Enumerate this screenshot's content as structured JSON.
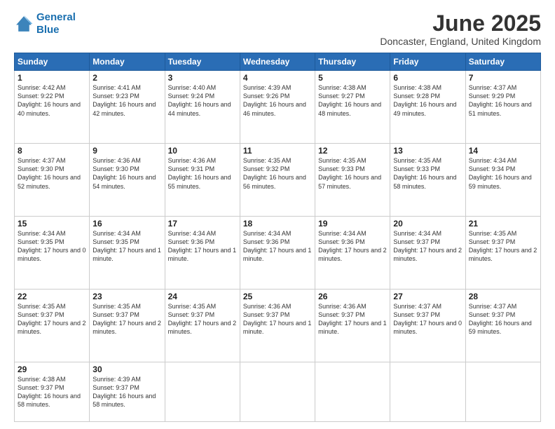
{
  "logo": {
    "line1": "General",
    "line2": "Blue"
  },
  "title": "June 2025",
  "location": "Doncaster, England, United Kingdom",
  "days_header": [
    "Sunday",
    "Monday",
    "Tuesday",
    "Wednesday",
    "Thursday",
    "Friday",
    "Saturday"
  ],
  "weeks": [
    [
      {
        "day": "1",
        "rise": "Sunrise: 4:42 AM",
        "set": "Sunset: 9:22 PM",
        "daylight": "Daylight: 16 hours and 40 minutes."
      },
      {
        "day": "2",
        "rise": "Sunrise: 4:41 AM",
        "set": "Sunset: 9:23 PM",
        "daylight": "Daylight: 16 hours and 42 minutes."
      },
      {
        "day": "3",
        "rise": "Sunrise: 4:40 AM",
        "set": "Sunset: 9:24 PM",
        "daylight": "Daylight: 16 hours and 44 minutes."
      },
      {
        "day": "4",
        "rise": "Sunrise: 4:39 AM",
        "set": "Sunset: 9:26 PM",
        "daylight": "Daylight: 16 hours and 46 minutes."
      },
      {
        "day": "5",
        "rise": "Sunrise: 4:38 AM",
        "set": "Sunset: 9:27 PM",
        "daylight": "Daylight: 16 hours and 48 minutes."
      },
      {
        "day": "6",
        "rise": "Sunrise: 4:38 AM",
        "set": "Sunset: 9:28 PM",
        "daylight": "Daylight: 16 hours and 49 minutes."
      },
      {
        "day": "7",
        "rise": "Sunrise: 4:37 AM",
        "set": "Sunset: 9:29 PM",
        "daylight": "Daylight: 16 hours and 51 minutes."
      }
    ],
    [
      {
        "day": "8",
        "rise": "Sunrise: 4:37 AM",
        "set": "Sunset: 9:30 PM",
        "daylight": "Daylight: 16 hours and 52 minutes."
      },
      {
        "day": "9",
        "rise": "Sunrise: 4:36 AM",
        "set": "Sunset: 9:30 PM",
        "daylight": "Daylight: 16 hours and 54 minutes."
      },
      {
        "day": "10",
        "rise": "Sunrise: 4:36 AM",
        "set": "Sunset: 9:31 PM",
        "daylight": "Daylight: 16 hours and 55 minutes."
      },
      {
        "day": "11",
        "rise": "Sunrise: 4:35 AM",
        "set": "Sunset: 9:32 PM",
        "daylight": "Daylight: 16 hours and 56 minutes."
      },
      {
        "day": "12",
        "rise": "Sunrise: 4:35 AM",
        "set": "Sunset: 9:33 PM",
        "daylight": "Daylight: 16 hours and 57 minutes."
      },
      {
        "day": "13",
        "rise": "Sunrise: 4:35 AM",
        "set": "Sunset: 9:33 PM",
        "daylight": "Daylight: 16 hours and 58 minutes."
      },
      {
        "day": "14",
        "rise": "Sunrise: 4:34 AM",
        "set": "Sunset: 9:34 PM",
        "daylight": "Daylight: 16 hours and 59 minutes."
      }
    ],
    [
      {
        "day": "15",
        "rise": "Sunrise: 4:34 AM",
        "set": "Sunset: 9:35 PM",
        "daylight": "Daylight: 17 hours and 0 minutes."
      },
      {
        "day": "16",
        "rise": "Sunrise: 4:34 AM",
        "set": "Sunset: 9:35 PM",
        "daylight": "Daylight: 17 hours and 1 minute."
      },
      {
        "day": "17",
        "rise": "Sunrise: 4:34 AM",
        "set": "Sunset: 9:36 PM",
        "daylight": "Daylight: 17 hours and 1 minute."
      },
      {
        "day": "18",
        "rise": "Sunrise: 4:34 AM",
        "set": "Sunset: 9:36 PM",
        "daylight": "Daylight: 17 hours and 1 minute."
      },
      {
        "day": "19",
        "rise": "Sunrise: 4:34 AM",
        "set": "Sunset: 9:36 PM",
        "daylight": "Daylight: 17 hours and 2 minutes."
      },
      {
        "day": "20",
        "rise": "Sunrise: 4:34 AM",
        "set": "Sunset: 9:37 PM",
        "daylight": "Daylight: 17 hours and 2 minutes."
      },
      {
        "day": "21",
        "rise": "Sunrise: 4:35 AM",
        "set": "Sunset: 9:37 PM",
        "daylight": "Daylight: 17 hours and 2 minutes."
      }
    ],
    [
      {
        "day": "22",
        "rise": "Sunrise: 4:35 AM",
        "set": "Sunset: 9:37 PM",
        "daylight": "Daylight: 17 hours and 2 minutes."
      },
      {
        "day": "23",
        "rise": "Sunrise: 4:35 AM",
        "set": "Sunset: 9:37 PM",
        "daylight": "Daylight: 17 hours and 2 minutes."
      },
      {
        "day": "24",
        "rise": "Sunrise: 4:35 AM",
        "set": "Sunset: 9:37 PM",
        "daylight": "Daylight: 17 hours and 2 minutes."
      },
      {
        "day": "25",
        "rise": "Sunrise: 4:36 AM",
        "set": "Sunset: 9:37 PM",
        "daylight": "Daylight: 17 hours and 1 minute."
      },
      {
        "day": "26",
        "rise": "Sunrise: 4:36 AM",
        "set": "Sunset: 9:37 PM",
        "daylight": "Daylight: 17 hours and 1 minute."
      },
      {
        "day": "27",
        "rise": "Sunrise: 4:37 AM",
        "set": "Sunset: 9:37 PM",
        "daylight": "Daylight: 17 hours and 0 minutes."
      },
      {
        "day": "28",
        "rise": "Sunrise: 4:37 AM",
        "set": "Sunset: 9:37 PM",
        "daylight": "Daylight: 16 hours and 59 minutes."
      }
    ],
    [
      {
        "day": "29",
        "rise": "Sunrise: 4:38 AM",
        "set": "Sunset: 9:37 PM",
        "daylight": "Daylight: 16 hours and 58 minutes."
      },
      {
        "day": "30",
        "rise": "Sunrise: 4:39 AM",
        "set": "Sunset: 9:37 PM",
        "daylight": "Daylight: 16 hours and 58 minutes."
      },
      null,
      null,
      null,
      null,
      null
    ]
  ]
}
